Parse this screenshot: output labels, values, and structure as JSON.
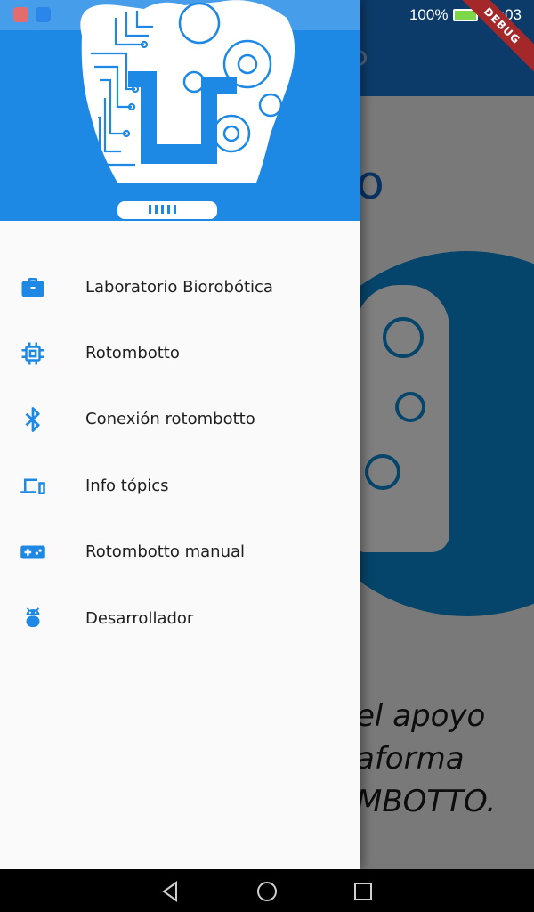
{
  "statusbar": {
    "battery_percent": "100%",
    "time": "19:03",
    "app_icon_colors": [
      "#e36d6d",
      "#2a86e8"
    ]
  },
  "debug_banner": {
    "label": "DEBUG"
  },
  "background_screen": {
    "title_partial": "o",
    "text_lines": [
      "el apoyo",
      "aforma",
      "MBOTTO."
    ]
  },
  "drawer": {
    "header_logo": "rotombotto-robot-head-logo",
    "items": [
      {
        "label": "Laboratorio Biorobótica",
        "icon": "briefcase-icon"
      },
      {
        "label": "Rotombotto",
        "icon": "chip-icon"
      },
      {
        "label": "Conexión rotombotto",
        "icon": "bluetooth-icon"
      },
      {
        "label": "Info tópics",
        "icon": "devices-icon"
      },
      {
        "label": "Rotombotto manual",
        "icon": "gamepad-icon"
      },
      {
        "label": "Desarrollador",
        "icon": "android-icon"
      }
    ]
  },
  "colors": {
    "primary": "#1e88e5",
    "app_bar": "#1976d2",
    "icon": "#1e88e5",
    "debug_ribbon": "#a4282a"
  }
}
